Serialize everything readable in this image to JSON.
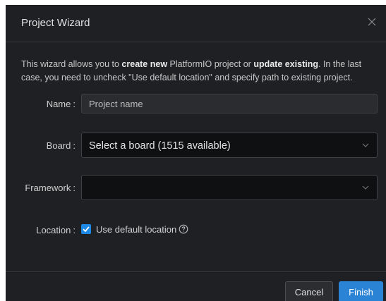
{
  "dialog": {
    "title": "Project Wizard"
  },
  "intro": {
    "part1": "This wizard allows you to ",
    "bold1": "create new",
    "part2": " PlatformIO project or ",
    "bold2": "update existing",
    "part3": ". In the last case, you need to uncheck \"Use default location\" and specify path to existing project."
  },
  "form": {
    "name": {
      "label": "Name",
      "colon": ":",
      "placeholder": "Project name",
      "value": ""
    },
    "board": {
      "label": "Board",
      "colon": ":",
      "selected": "Select a board (1515 available)"
    },
    "framework": {
      "label": "Framework",
      "colon": ":",
      "selected": ""
    },
    "location": {
      "label": "Location",
      "colon": ":",
      "checkbox_label": "Use default location",
      "checked": true
    }
  },
  "footer": {
    "cancel_label": "Cancel",
    "finish_label": "Finish"
  },
  "colors": {
    "accent": "#1e88e5",
    "primary_button": "#2b83d6",
    "dialog_bg": "#1e2023"
  },
  "icons": {
    "close": "close-icon",
    "chevron": "chevron-down-icon",
    "check": "check-icon",
    "help": "help-circle-icon"
  }
}
